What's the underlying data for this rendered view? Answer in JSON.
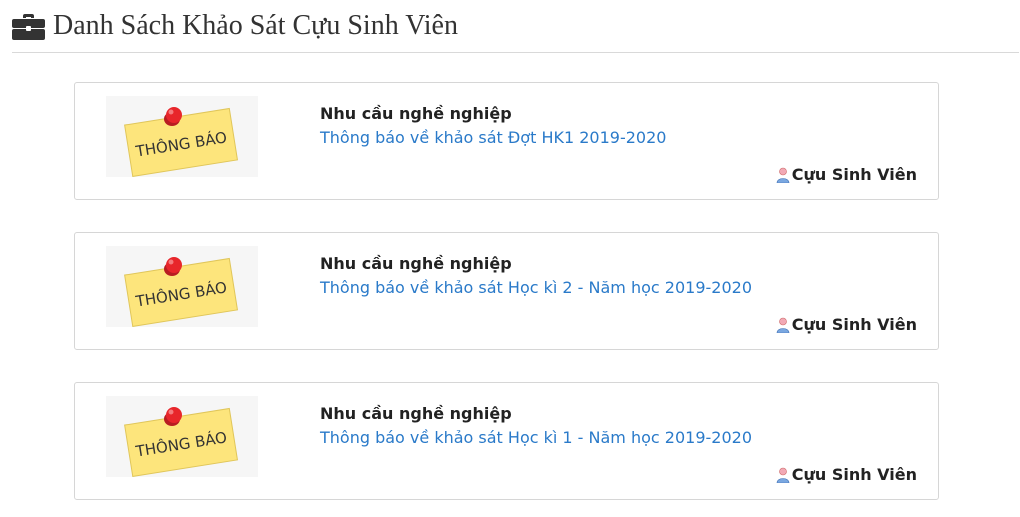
{
  "page": {
    "title": "Danh Sách Khảo Sát Cựu Sinh Viên",
    "title_icon": "briefcase-icon"
  },
  "surveys": [
    {
      "category": "Nhu cầu nghề nghiệp",
      "title": "Thông báo về khảo sát Đợt HK1 2019-2020",
      "author": "Cựu Sinh Viên",
      "thumbnail_text": "THÔNG BÁO",
      "author_icon": "user-icon"
    },
    {
      "category": "Nhu cầu nghề nghiệp",
      "title": "Thông báo về khảo sát Học kì 2 - Năm học 2019-2020",
      "author": "Cựu Sinh Viên",
      "thumbnail_text": "THÔNG BÁO",
      "author_icon": "user-icon"
    },
    {
      "category": "Nhu cầu nghề nghiệp",
      "title": "Thông báo về khảo sát Học kì 1 - Năm học 2019-2020",
      "author": "Cựu Sinh Viên",
      "thumbnail_text": "THÔNG BÁO",
      "author_icon": "user-icon"
    }
  ],
  "colors": {
    "link": "#2a7ac9",
    "note": "#fde57c",
    "pin": "#e8262b"
  }
}
